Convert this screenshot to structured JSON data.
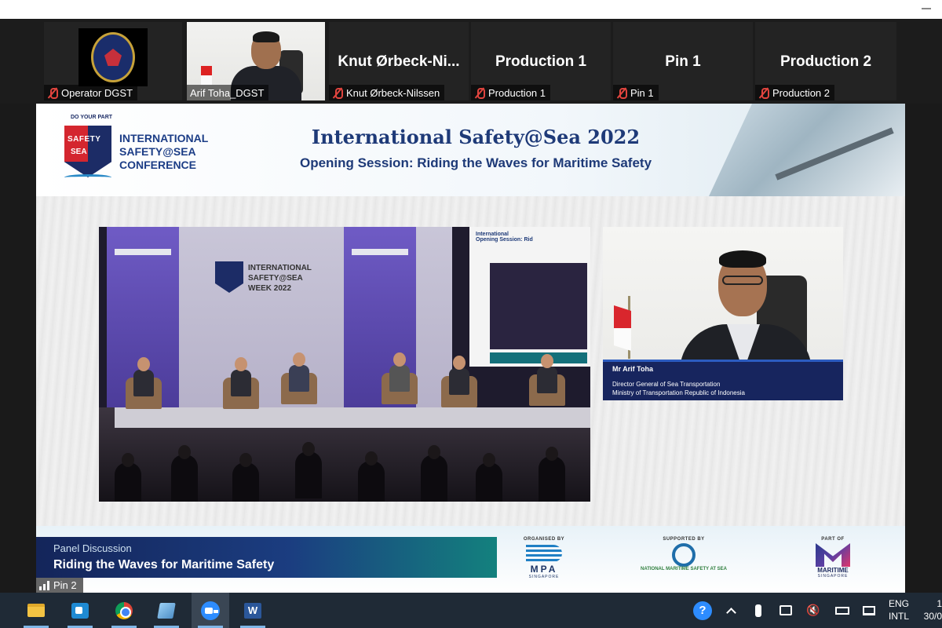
{
  "participants": [
    {
      "name": "Operator DGST",
      "display": ""
    },
    {
      "name": "Arif Toha_DGST",
      "display": ""
    },
    {
      "name": "Knut Ørbeck-Nilssen",
      "display": "Knut Ørbeck-Ni..."
    },
    {
      "name": "Production 1",
      "display": "Production 1"
    },
    {
      "name": "Pin 1",
      "display": "Pin 1"
    },
    {
      "name": "Production 2",
      "display": "Production 2"
    }
  ],
  "banner": {
    "logo_top": "DO YOUR PART",
    "logo_shield_1": "SAFETY",
    "logo_shield_2": "SEA",
    "logo_lines": [
      "INTERNATIONAL",
      "SAFETY@SEA",
      "CONFERENCE"
    ],
    "title": "International Safety@Sea 2022",
    "subtitle": "Opening Session: Riding the Waves for Maritime Safety"
  },
  "stage": {
    "backdrop_lines": [
      "INTERNATIONAL",
      "SAFETY@SEA",
      "WEEK 2022"
    ],
    "screen_header": "International",
    "screen_sub": "Opening Session: Rid"
  },
  "speaker": {
    "name": "Mr Arif Toha",
    "title_1": "Director General of Sea Transportation",
    "title_2": "Ministry of Transportation Republic of Indonesia"
  },
  "lower_third": {
    "label": "Panel Discussion",
    "title": "Riding the Waves for Maritime Safety",
    "organised_by": "ORGANISED BY",
    "supported_by": "SUPPORTED BY",
    "part_of": "PART OF",
    "mpa": "MPA",
    "mpa_sub": "SINGAPORE",
    "support_logo": "NATIONAL MARITIME SAFETY AT SEA",
    "maritime": "MARITIME",
    "maritime_sub": "SINGAPORE"
  },
  "active_tile": "Pin 2",
  "taskbar": {
    "apps": [
      "folder-icon",
      "meet-icon",
      "chrome-icon",
      "notes-icon",
      "zoom-icon",
      "word-icon"
    ],
    "word_letter": "W",
    "help": "?",
    "lang_1": "ENG",
    "lang_2": "INTL",
    "time": "1",
    "date": "30/0"
  },
  "colors": {
    "muted_mic": "#e0443e",
    "banner_navy": "#1e3a78",
    "taskbar": "#1f2a36"
  }
}
